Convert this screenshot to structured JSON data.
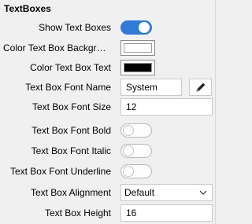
{
  "section": {
    "title": "TextBoxes"
  },
  "rows": {
    "show_text_boxes": {
      "label": "Show Text Boxes",
      "on": true
    },
    "color_bg": {
      "label": "Color Text Box Background",
      "color": "#ffffff"
    },
    "color_text": {
      "label": "Color Text Box Text",
      "color": "#000000"
    },
    "font_name": {
      "label": "Text Box Font Name",
      "value": "System"
    },
    "font_size": {
      "label": "Text Box Font Size",
      "value": "12"
    },
    "font_bold": {
      "label": "Text Box Font Bold",
      "on": false
    },
    "font_italic": {
      "label": "Text Box Font Italic",
      "on": false
    },
    "font_underline": {
      "label": "Text Box Font Underline",
      "on": false
    },
    "alignment": {
      "label": "Text Box Alignment",
      "value": "Default"
    },
    "height": {
      "label": "Text Box Height",
      "value": "16"
    }
  },
  "colors": {
    "accent": "#2f7bd6"
  },
  "icons": {
    "edit": "pen-icon",
    "dropdown": "chevron-down-icon"
  }
}
